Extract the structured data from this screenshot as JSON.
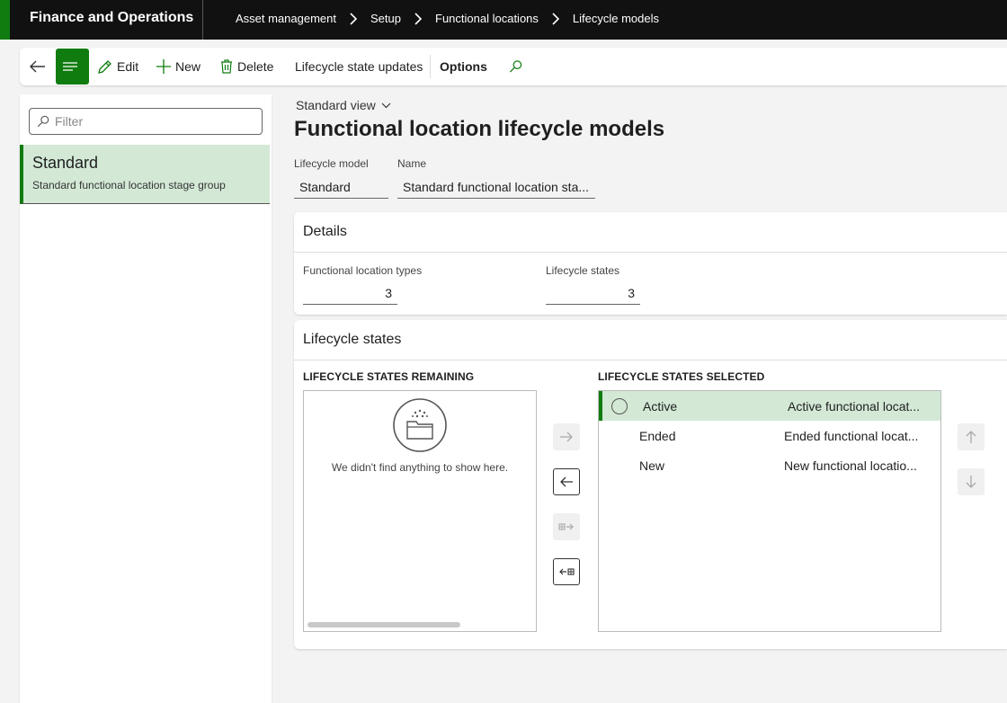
{
  "app": {
    "title": "Finance and Operations"
  },
  "breadcrumb": [
    "Asset management",
    "Setup",
    "Functional locations",
    "Lifecycle models"
  ],
  "toolbar": {
    "edit": "Edit",
    "new": "New",
    "delete": "Delete",
    "lifecycle_state_updates": "Lifecycle state updates",
    "options": "Options"
  },
  "list": {
    "filter_placeholder": "Filter",
    "items": [
      {
        "title": "Standard",
        "subtitle": "Standard functional location stage group"
      }
    ]
  },
  "main": {
    "view": "Standard view",
    "title": "Functional location lifecycle models",
    "header": {
      "lifecycle_model_label": "Lifecycle model",
      "lifecycle_model_value": "Standard",
      "name_label": "Name",
      "name_value": "Standard functional location sta..."
    },
    "details": {
      "title": "Details",
      "functional_location_types_label": "Functional location types",
      "functional_location_types_value": "3",
      "lifecycle_states_label": "Lifecycle states",
      "lifecycle_states_value": "3"
    },
    "lifecycle_states": {
      "title": "Lifecycle states",
      "remaining_label": "LIFECYCLE STATES REMAINING",
      "selected_label": "LIFECYCLE STATES SELECTED",
      "empty_text": "We didn't find anything to show here.",
      "selected_rows": [
        {
          "state": "Active",
          "description": "Active functional locat..."
        },
        {
          "state": "Ended",
          "description": "Ended functional locat..."
        },
        {
          "state": "New",
          "description": "New functional locatio..."
        }
      ]
    }
  },
  "colors": {
    "accent": "#107c10",
    "selected_bg": "#d3e9d6",
    "topbar_bg": "#111111"
  }
}
